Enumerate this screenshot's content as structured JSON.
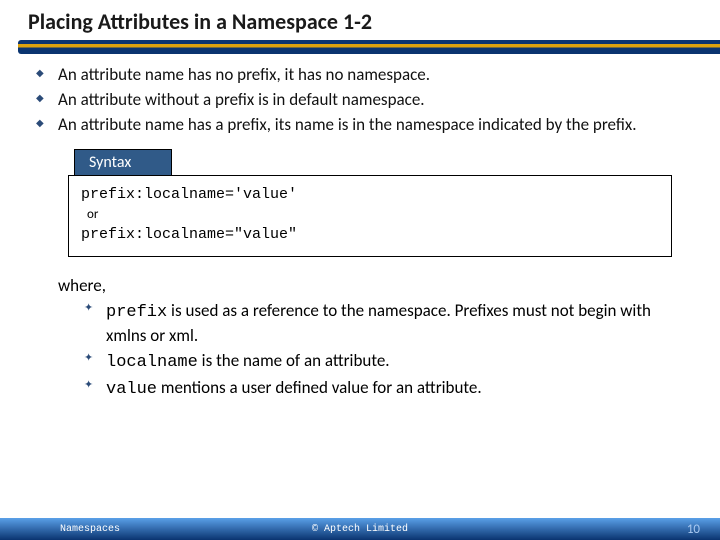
{
  "header": {
    "title": "Placing Attributes in a Namespace 1-2"
  },
  "bullets": [
    "An attribute name has no prefix, it has no namespace.",
    "An attribute without a prefix is in default namespace.",
    "An attribute name has a prefix, its name is in the namespace indicated by the prefix."
  ],
  "syntax": {
    "label": "Syntax",
    "line1": "prefix:localname='value'",
    "or": "or",
    "line2": "prefix:localname=\"value\""
  },
  "where": {
    "label": "where,",
    "items": [
      {
        "code": "prefix",
        "rest": " is used as a reference to the namespace. Prefixes must not begin with xmlns or xml."
      },
      {
        "code": "localname",
        "rest": " is the name of an attribute."
      },
      {
        "code": "value",
        "rest": " mentions a user defined value for an attribute."
      }
    ]
  },
  "footer": {
    "left": "Namespaces",
    "center": "© Aptech Limited",
    "page": "10"
  }
}
